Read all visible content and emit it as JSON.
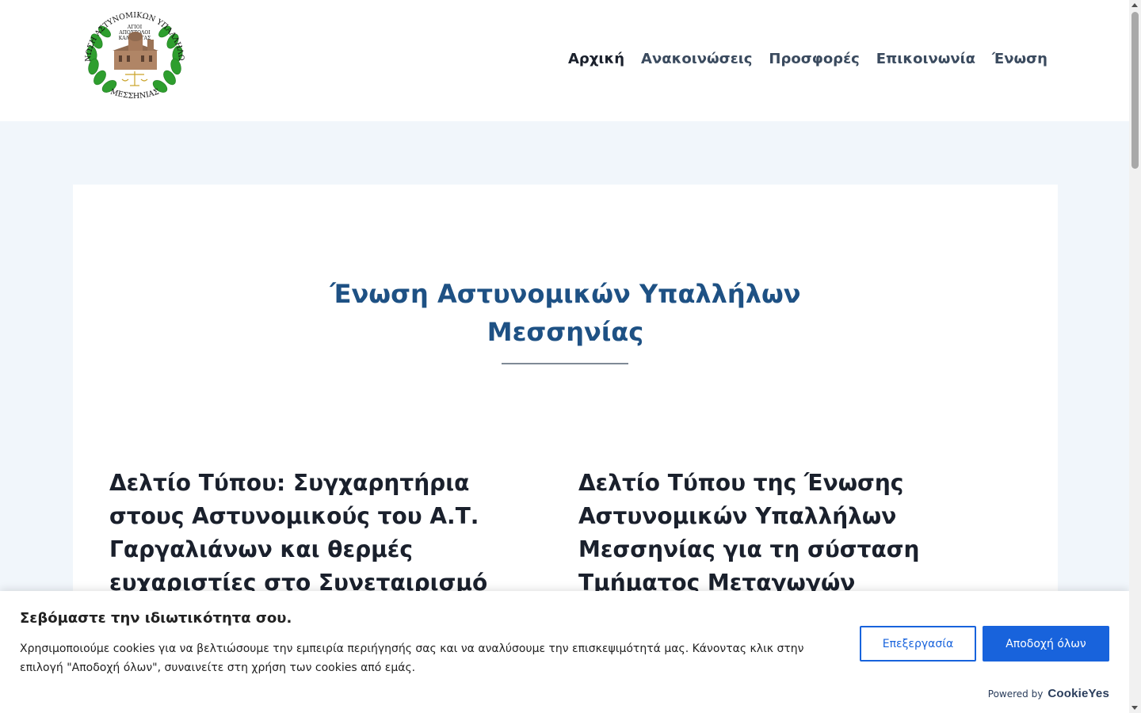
{
  "header": {
    "logo": {
      "icon": "police-union-seal-icon",
      "ring_text": "ΕΝΩΣΗ ΑΣΤΥΝΟΜΙΚΩΝ ΥΠΑΛΛΗΛΩΝ",
      "inner_line_1": "ΑΓΙΟΙ",
      "inner_line_2": "ΑΠΟΣΤΟΛΟΙ",
      "inner_line_3": "ΚΑΛΑΜΑΤΑΣ",
      "bottom_text": "ΜΕΣΣΗΝΙΑΣ"
    },
    "nav": [
      {
        "label": "Αρχική",
        "active": true
      },
      {
        "label": "Ανακοινώσεις"
      },
      {
        "label": "Προσφορές"
      },
      {
        "label": "Επικοινωνία"
      },
      {
        "label": "Ένωση"
      }
    ]
  },
  "main": {
    "title": "Ένωση Αστυνομικών Υπαλλήλων Μεσσηνίας",
    "posts": [
      {
        "title": "Δελτίο Τύπου: Συγχαρητήρια στους Αστυνομικούς του Α.Τ. Γαργαλιάνων και θερμές ευχαριστίες στο Συνεταιρισμό"
      },
      {
        "title": "Δελτίο Τύπου της Ένωσης Αστυνομικών Υπαλλήλων Μεσσηνίας για τη σύσταση Τμήματος Μεταγωγών"
      }
    ]
  },
  "cookie_banner": {
    "heading": "Σεβόμαστε την ιδιωτικότητα σου.",
    "text": "Χρησιμοποιούμε cookies για να βελτιώσουμε την εμπειρία περιήγησής σας και να αναλύσουμε την επισκεψιμότητά μας. Κάνοντας κλικ στην επιλογή \"Αποδοχή όλων\", συναινείτε στη χρήση των cookies από εμάς.",
    "customize_label": "Επεξεργασία",
    "accept_label": "Αποδοχή όλων",
    "powered_by": "Powered by",
    "brand": "CookieYes"
  },
  "colors": {
    "title_blue": "#1e5184",
    "accent_button": "#1863dc",
    "page_bg": "#f1f6fb",
    "laurel_green": "#2e9e2e"
  }
}
